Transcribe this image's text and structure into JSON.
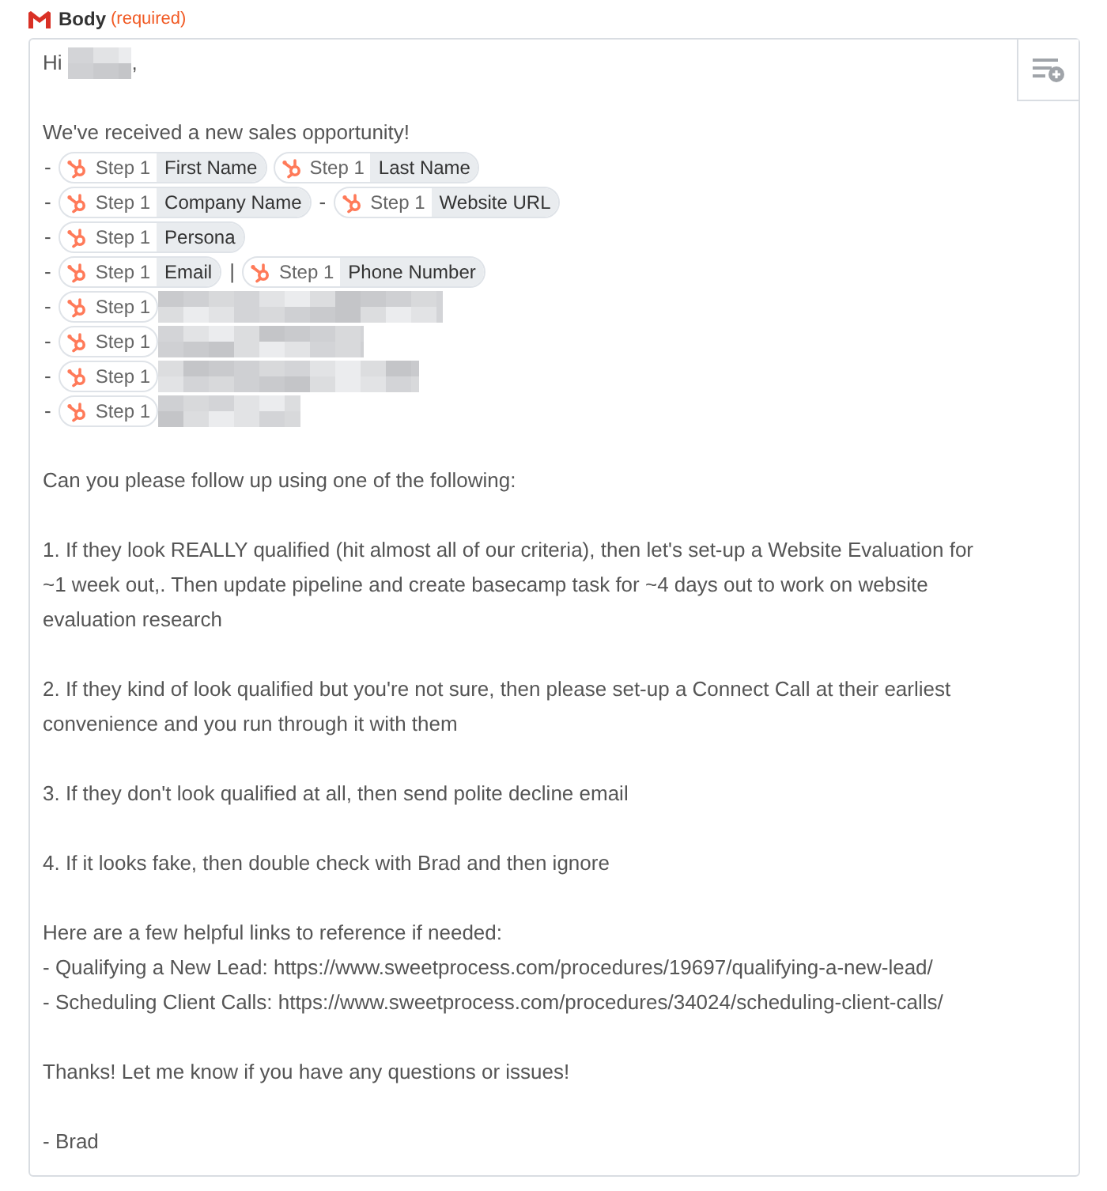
{
  "field": {
    "label": "Body",
    "required": "(required)"
  },
  "lines": [
    {
      "kind": "greeting",
      "text": "Hi",
      "after": ","
    },
    {
      "kind": "blank"
    },
    {
      "kind": "text",
      "lines": [
        "We've received a new sales opportunity!"
      ]
    },
    {
      "kind": "fields",
      "parts": [
        {
          "kind": "text",
          "text": "-"
        },
        {
          "kind": "pill",
          "step": "Step 1",
          "field": "First Name"
        },
        {
          "kind": "pill",
          "step": "Step 1",
          "field": "Last Name"
        }
      ]
    },
    {
      "kind": "fields",
      "parts": [
        {
          "kind": "text",
          "text": "-"
        },
        {
          "kind": "pill",
          "step": "Step 1",
          "field": "Company Name"
        },
        {
          "kind": "text",
          "text": "-"
        },
        {
          "kind": "pill",
          "step": "Step 1",
          "field": "Website URL"
        }
      ]
    },
    {
      "kind": "fields",
      "parts": [
        {
          "kind": "text",
          "text": "-"
        },
        {
          "kind": "pill",
          "step": "Step 1",
          "field": "Persona"
        }
      ]
    },
    {
      "kind": "fields",
      "parts": [
        {
          "kind": "text",
          "text": "-"
        },
        {
          "kind": "pill",
          "step": "Step 1",
          "field": "Email"
        },
        {
          "kind": "text",
          "text": "|"
        },
        {
          "kind": "pill",
          "step": "Step 1",
          "field": "Phone Number"
        }
      ]
    },
    {
      "kind": "fields",
      "parts": [
        {
          "kind": "text",
          "text": "-"
        },
        {
          "kind": "pill",
          "step": "Step 1",
          "redacted": true
        }
      ]
    },
    {
      "kind": "fields",
      "parts": [
        {
          "kind": "text",
          "text": "-"
        },
        {
          "kind": "pill",
          "step": "Step 1",
          "redacted": true
        }
      ]
    },
    {
      "kind": "fields",
      "parts": [
        {
          "kind": "text",
          "text": "-"
        },
        {
          "kind": "pill",
          "step": "Step 1",
          "redacted": true
        }
      ]
    },
    {
      "kind": "fields",
      "parts": [
        {
          "kind": "text",
          "text": "-"
        },
        {
          "kind": "pill",
          "step": "Step 1",
          "redacted": true
        }
      ]
    },
    {
      "kind": "blank"
    },
    {
      "kind": "text",
      "lines": [
        "Can you please follow up using one of the following:"
      ]
    },
    {
      "kind": "blank"
    },
    {
      "kind": "text",
      "lines": [
        "1. If they look REALLY qualified (hit almost all of our criteria), then let's set-up a Website Evaluation for",
        "~1 week out,. Then update pipeline and create basecamp task for ~4 days out to work on website",
        "evaluation research"
      ]
    },
    {
      "kind": "blank"
    },
    {
      "kind": "text",
      "lines": [
        "2. If they kind of look qualified but you're not sure, then please set-up a Connect Call at their earliest",
        "convenience and you run through it with them"
      ]
    },
    {
      "kind": "blank"
    },
    {
      "kind": "text",
      "lines": [
        "3. If they don't look qualified at all, then send polite decline email"
      ]
    },
    {
      "kind": "blank"
    },
    {
      "kind": "text",
      "lines": [
        "4. If it looks fake, then double check with Brad and then ignore"
      ]
    },
    {
      "kind": "blank"
    },
    {
      "kind": "text",
      "lines": [
        "Here are a few helpful links to reference if needed:",
        "- Qualifying a New Lead: https://www.sweetprocess.com/procedures/19697/qualifying-a-new-lead/",
        "- Scheduling Client Calls: https://www.sweetprocess.com/procedures/34024/scheduling-client-calls/"
      ]
    },
    {
      "kind": "blank"
    },
    {
      "kind": "text",
      "lines": [
        "Thanks! Let me know if you have any questions or issues!"
      ]
    },
    {
      "kind": "blank"
    },
    {
      "kind": "text",
      "lines": [
        "- Brad"
      ]
    }
  ]
}
